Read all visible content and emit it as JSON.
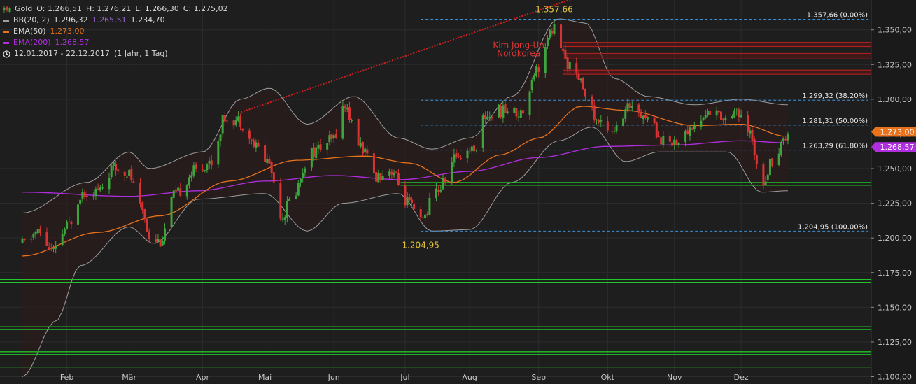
{
  "legend": {
    "instrument": "Gold",
    "ohlc": {
      "o": "O: 1.266,51",
      "h": "H: 1.276,21",
      "l": "L: 1.266,30",
      "c": "C: 1.275,02"
    },
    "bb": {
      "label": "BB(20, 2)",
      "v1": "1.296,32",
      "v2": "1.265,51",
      "v3": "1.234,70",
      "color": "#9e9e9e",
      "mid_color": "#9c6ad6"
    },
    "ema50": {
      "label": "EMA(50)",
      "value": "1.273,00",
      "color": "#e8731c"
    },
    "ema200": {
      "label": "EMA(200)",
      "value": "1.268,57",
      "color": "#b12ee0"
    },
    "period": {
      "range": "12.01.2017 - 22.12.2017",
      "interval": "(1 Jahr, 1 Tag)"
    }
  },
  "colors": {
    "up": "#3ea43e",
    "down": "#d93434",
    "fib": "#3b8fd6",
    "support": "#22c42a",
    "resistance": "#a82020",
    "trend": "#d42020",
    "annotation": "#e0c23a"
  },
  "chart_data": {
    "type": "candlestick",
    "instrument": "Gold",
    "period": "12.01.2017 - 22.12.2017",
    "y_axis": {
      "ylim": [
        1100,
        1382
      ],
      "ticks": [
        1350,
        1325,
        1300,
        1275,
        1250,
        1225,
        1200,
        1175,
        1150,
        1125,
        1100
      ],
      "tick_labels": [
        "1.350,00",
        "1.325,00",
        "1.300,00",
        "1.275,00",
        "1.250,00",
        "1.225,00",
        "1.200,00",
        "1.175,00",
        "1.150,00",
        "1.125,00",
        "1.100,00"
      ]
    },
    "x_axis": {
      "months": [
        "Feb",
        "Mär",
        "Apr",
        "Mai",
        "Jun",
        "Jul",
        "Aug",
        "Sep",
        "Okt",
        "Nov",
        "Dez"
      ],
      "month_start_dates": [
        "2017-02-01",
        "2017-03-01",
        "2017-04-03",
        "2017-05-01",
        "2017-06-01",
        "2017-07-03",
        "2017-08-01",
        "2017-09-01",
        "2017-10-02",
        "2017-11-01",
        "2017-12-01"
      ]
    },
    "fibonacci": {
      "high": 1357.66,
      "low": 1204.95,
      "levels": [
        {
          "pct": "0.00%",
          "value": 1357.66,
          "label": "1.357,66 (0.00%)"
        },
        {
          "pct": "38.20%",
          "value": 1299.32,
          "label": "1.299,32 (38.20%)"
        },
        {
          "pct": "50.00%",
          "value": 1281.31,
          "label": "1.281,31 (50.00%)"
        },
        {
          "pct": "61.80%",
          "value": 1263.29,
          "label": "1.263,29 (61.80%)"
        },
        {
          "pct": "100.00%",
          "value": 1204.95,
          "label": "1.204,95 (100.00%)"
        }
      ]
    },
    "resistance_levels": [
      1341,
      1338,
      1333,
      1329,
      1321,
      1318
    ],
    "support_levels": [
      1240,
      1238,
      1170,
      1168,
      1136,
      1134,
      1118,
      1116,
      1107
    ],
    "annotations": [
      {
        "text": "1.357,66",
        "date": "2017-09-08",
        "value": 1357.66
      },
      {
        "text": "1.204,95",
        "date": "2017-07-10",
        "value": 1204.95
      },
      {
        "text": "Kim Jong-Un",
        "date": "2017-08-23",
        "value": 1337
      },
      {
        "text": "Nordkorea",
        "date": "2017-08-23",
        "value": 1331
      }
    ],
    "trendline": {
      "from": [
        "2017-04-19",
        1290
      ],
      "to": [
        "2017-10-22",
        1392
      ]
    },
    "current_price_labels": [
      {
        "text": "1.273,00",
        "value": 1273.0
      },
      {
        "text": "1.268,57",
        "value": 1268.57
      }
    ],
    "path_anchors": [
      [
        "2017-01-12",
        1196
      ],
      [
        "2017-01-19",
        1204
      ],
      [
        "2017-01-26",
        1190
      ],
      [
        "2017-02-01",
        1208
      ],
      [
        "2017-02-08",
        1233
      ],
      [
        "2017-02-15",
        1234
      ],
      [
        "2017-02-22",
        1250
      ],
      [
        "2017-02-28",
        1248
      ],
      [
        "2017-03-07",
        1220
      ],
      [
        "2017-03-10",
        1202
      ],
      [
        "2017-03-15",
        1198
      ],
      [
        "2017-03-21",
        1230
      ],
      [
        "2017-03-31",
        1249
      ],
      [
        "2017-04-07",
        1255
      ],
      [
        "2017-04-13",
        1287
      ],
      [
        "2017-04-19",
        1285
      ],
      [
        "2017-04-27",
        1266
      ],
      [
        "2017-05-02",
        1256
      ],
      [
        "2017-05-09",
        1216
      ],
      [
        "2017-05-12",
        1226
      ],
      [
        "2017-05-22",
        1262
      ],
      [
        "2017-05-31",
        1270
      ],
      [
        "2017-06-06",
        1295
      ],
      [
        "2017-06-12",
        1268
      ],
      [
        "2017-06-20",
        1245
      ],
      [
        "2017-06-27",
        1249
      ],
      [
        "2017-07-03",
        1227
      ],
      [
        "2017-07-10",
        1212
      ],
      [
        "2017-07-17",
        1234
      ],
      [
        "2017-07-27",
        1260
      ],
      [
        "2017-08-03",
        1265
      ],
      [
        "2017-08-08",
        1288
      ],
      [
        "2017-08-17",
        1292
      ],
      [
        "2017-08-24",
        1290
      ],
      [
        "2017-08-31",
        1322
      ],
      [
        "2017-09-08",
        1351
      ],
      [
        "2017-09-14",
        1326
      ],
      [
        "2017-09-20",
        1311
      ],
      [
        "2017-09-28",
        1283
      ],
      [
        "2017-10-06",
        1278
      ],
      [
        "2017-10-13",
        1297
      ],
      [
        "2017-10-20",
        1287
      ],
      [
        "2017-10-27",
        1270
      ],
      [
        "2017-11-03",
        1270
      ],
      [
        "2017-11-10",
        1281
      ],
      [
        "2017-11-17",
        1291
      ],
      [
        "2017-11-24",
        1287
      ],
      [
        "2017-11-28",
        1293
      ],
      [
        "2017-12-04",
        1276
      ],
      [
        "2017-12-11",
        1242
      ],
      [
        "2017-12-15",
        1256
      ],
      [
        "2017-12-22",
        1275
      ]
    ],
    "bollinger_upper": [
      [
        "2017-01-12",
        1218
      ],
      [
        "2017-02-10",
        1240
      ],
      [
        "2017-03-01",
        1262
      ],
      [
        "2017-03-10",
        1250
      ],
      [
        "2017-04-03",
        1262
      ],
      [
        "2017-04-20",
        1300
      ],
      [
        "2017-05-03",
        1308
      ],
      [
        "2017-05-20",
        1282
      ],
      [
        "2017-06-10",
        1302
      ],
      [
        "2017-06-30",
        1272
      ],
      [
        "2017-07-15",
        1264
      ],
      [
        "2017-08-01",
        1272
      ],
      [
        "2017-08-20",
        1302
      ],
      [
        "2017-09-10",
        1358
      ],
      [
        "2017-09-22",
        1355
      ],
      [
        "2017-10-05",
        1315
      ],
      [
        "2017-10-20",
        1302
      ],
      [
        "2017-11-10",
        1296
      ],
      [
        "2017-12-01",
        1300
      ],
      [
        "2017-12-22",
        1296
      ]
    ],
    "bollinger_lower": [
      [
        "2017-01-12",
        1100
      ],
      [
        "2017-01-27",
        1140
      ],
      [
        "2017-02-07",
        1180
      ],
      [
        "2017-03-01",
        1208
      ],
      [
        "2017-03-12",
        1196
      ],
      [
        "2017-04-01",
        1228
      ],
      [
        "2017-05-01",
        1232
      ],
      [
        "2017-05-20",
        1205
      ],
      [
        "2017-06-05",
        1225
      ],
      [
        "2017-06-30",
        1232
      ],
      [
        "2017-07-15",
        1205
      ],
      [
        "2017-08-01",
        1206
      ],
      [
        "2017-08-20",
        1240
      ],
      [
        "2017-09-10",
        1270
      ],
      [
        "2017-09-25",
        1280
      ],
      [
        "2017-10-10",
        1255
      ],
      [
        "2017-10-25",
        1262
      ],
      [
        "2017-11-25",
        1262
      ],
      [
        "2017-12-10",
        1233
      ],
      [
        "2017-12-22",
        1234
      ]
    ],
    "bollinger_mid": [
      [
        "2017-01-12",
        1160
      ],
      [
        "2017-02-15",
        1205
      ],
      [
        "2017-03-10",
        1232
      ],
      [
        "2017-04-10",
        1245
      ],
      [
        "2017-05-01",
        1265
      ],
      [
        "2017-05-31",
        1255
      ],
      [
        "2017-06-25",
        1252
      ],
      [
        "2017-07-15",
        1238
      ],
      [
        "2017-08-15",
        1271
      ],
      [
        "2017-09-15",
        1310
      ],
      [
        "2017-10-10",
        1290
      ],
      [
        "2017-11-10",
        1280
      ],
      [
        "2017-12-01",
        1282
      ],
      [
        "2017-12-22",
        1266
      ]
    ],
    "ema50": [
      [
        "2017-01-12",
        1187
      ],
      [
        "2017-02-15",
        1204
      ],
      [
        "2017-03-15",
        1216
      ],
      [
        "2017-04-15",
        1241
      ],
      [
        "2017-05-15",
        1256
      ],
      [
        "2017-06-15",
        1259
      ],
      [
        "2017-07-05",
        1254
      ],
      [
        "2017-07-25",
        1240
      ],
      [
        "2017-08-15",
        1260
      ],
      [
        "2017-09-01",
        1272
      ],
      [
        "2017-09-20",
        1295
      ],
      [
        "2017-10-10",
        1292
      ],
      [
        "2017-11-10",
        1281
      ],
      [
        "2017-12-01",
        1282
      ],
      [
        "2017-12-22",
        1273
      ]
    ],
    "ema200": [
      [
        "2017-01-12",
        1233
      ],
      [
        "2017-03-01",
        1230
      ],
      [
        "2017-04-01",
        1234
      ],
      [
        "2017-05-01",
        1241
      ],
      [
        "2017-06-01",
        1245
      ],
      [
        "2017-07-01",
        1242
      ],
      [
        "2017-08-01",
        1248
      ],
      [
        "2017-09-01",
        1258
      ],
      [
        "2017-10-01",
        1266
      ],
      [
        "2017-11-01",
        1267
      ],
      [
        "2017-12-01",
        1270
      ],
      [
        "2017-12-22",
        1268.57
      ]
    ]
  }
}
